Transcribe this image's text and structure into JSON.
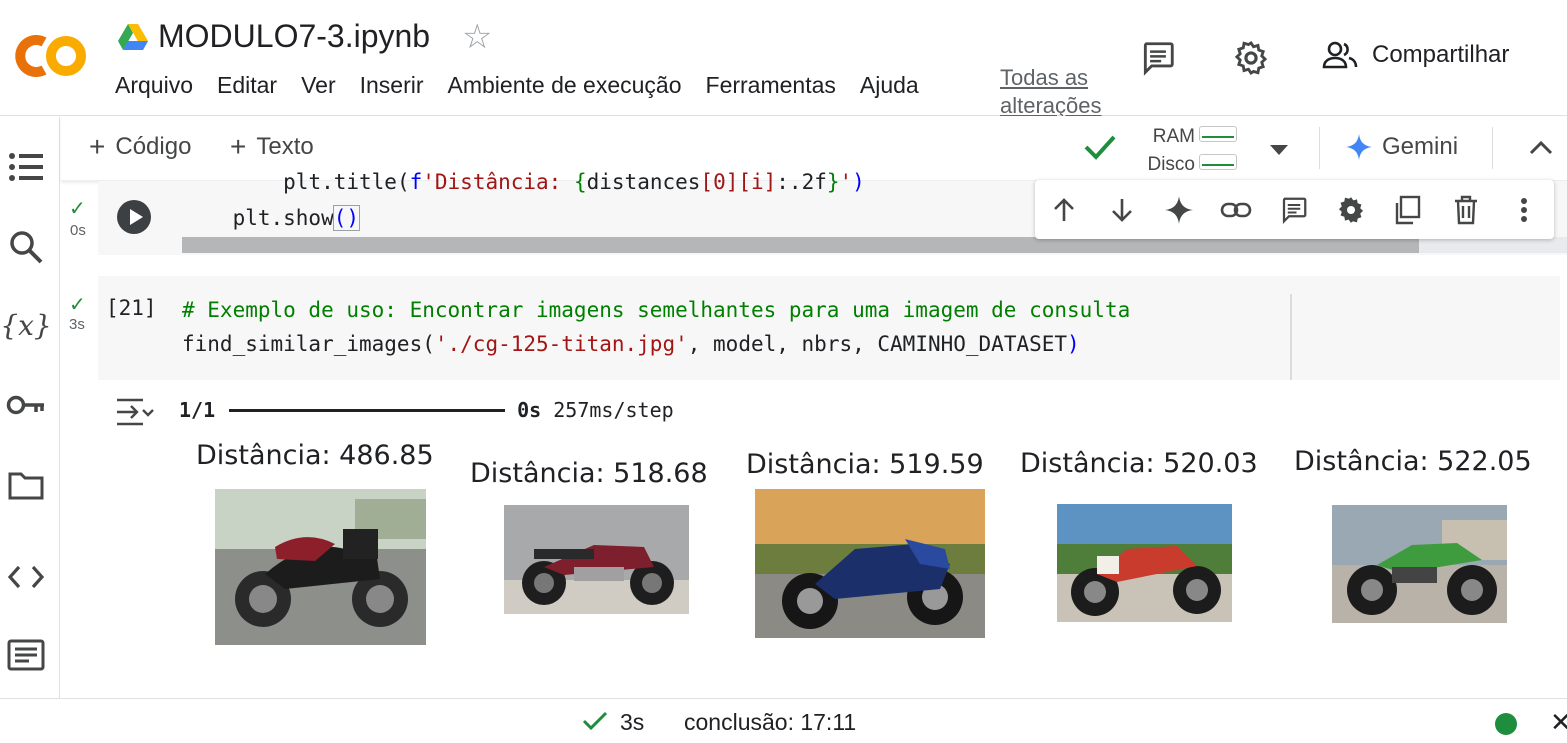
{
  "app": {
    "notebook_title": "MODULO7-3.ipynb",
    "changes_label": "Todas as alterações",
    "share_label": "Compartilhar"
  },
  "menu": [
    "Arquivo",
    "Editar",
    "Ver",
    "Inserir",
    "Ambiente de execução",
    "Ferramentas",
    "Ajuda"
  ],
  "toolbar": {
    "add_code": "Código",
    "add_text": "Texto",
    "ram_label": "RAM",
    "disk_label": "Disco",
    "gemini_label": "Gemini"
  },
  "cell1": {
    "status_time": "0s",
    "line1_indent": "        ",
    "line1": "plt.title(f'Distância: {distances[0][i]:.2f}')",
    "line2_indent": "    ",
    "line2": "plt.show()"
  },
  "cell2": {
    "exec_count": "[21]",
    "status_time": "3s",
    "comment": "# Exemplo de uso: Encontrar imagens semelhantes para uma imagem de consulta",
    "code_func": "find_similar_images(",
    "code_str": "'./cg-125-titan.jpg'",
    "code_args": ", model, nbrs, CAMINHO_DATASET",
    "code_close": ")"
  },
  "output": {
    "progress_count": "1/1",
    "progress_time": "0s",
    "progress_rate": "257ms/step",
    "results": [
      {
        "label": "Distância: 486.85",
        "photo": "motorcycle-photo-1"
      },
      {
        "label": "Distância: 518.68",
        "photo": "motorcycle-photo-2"
      },
      {
        "label": "Distância: 519.59",
        "photo": "motorcycle-photo-3"
      },
      {
        "label": "Distância: 520.03",
        "photo": "motorcycle-photo-4"
      },
      {
        "label": "Distância: 522.05",
        "photo": "motorcycle-photo-5"
      }
    ]
  },
  "statusbar": {
    "duration": "3s",
    "completion": "conclusão: 17:11"
  },
  "colors": {
    "accent_orange": "#f9ab00",
    "logo_orange": "#e8710a",
    "success_green": "#1e8e3e",
    "gemini_blue": "#4285f4",
    "code_green": "#008000",
    "code_red": "#a31515",
    "code_blue": "#0000ff"
  },
  "icons": [
    "colab-logo",
    "drive-icon",
    "star-icon",
    "comment-icon",
    "gear-icon",
    "people-icon",
    "toc-icon",
    "search-icon",
    "variables-icon",
    "key-icon",
    "folder-icon",
    "code-icon",
    "terminal-icon",
    "check-icon",
    "chevron-down-icon",
    "chevron-up-icon",
    "gemini-icon",
    "arrow-up-icon",
    "arrow-down-icon",
    "sparkle-icon",
    "link-icon",
    "copy-icon",
    "delete-icon",
    "more-icon",
    "output-toggle-icon",
    "close-icon"
  ]
}
